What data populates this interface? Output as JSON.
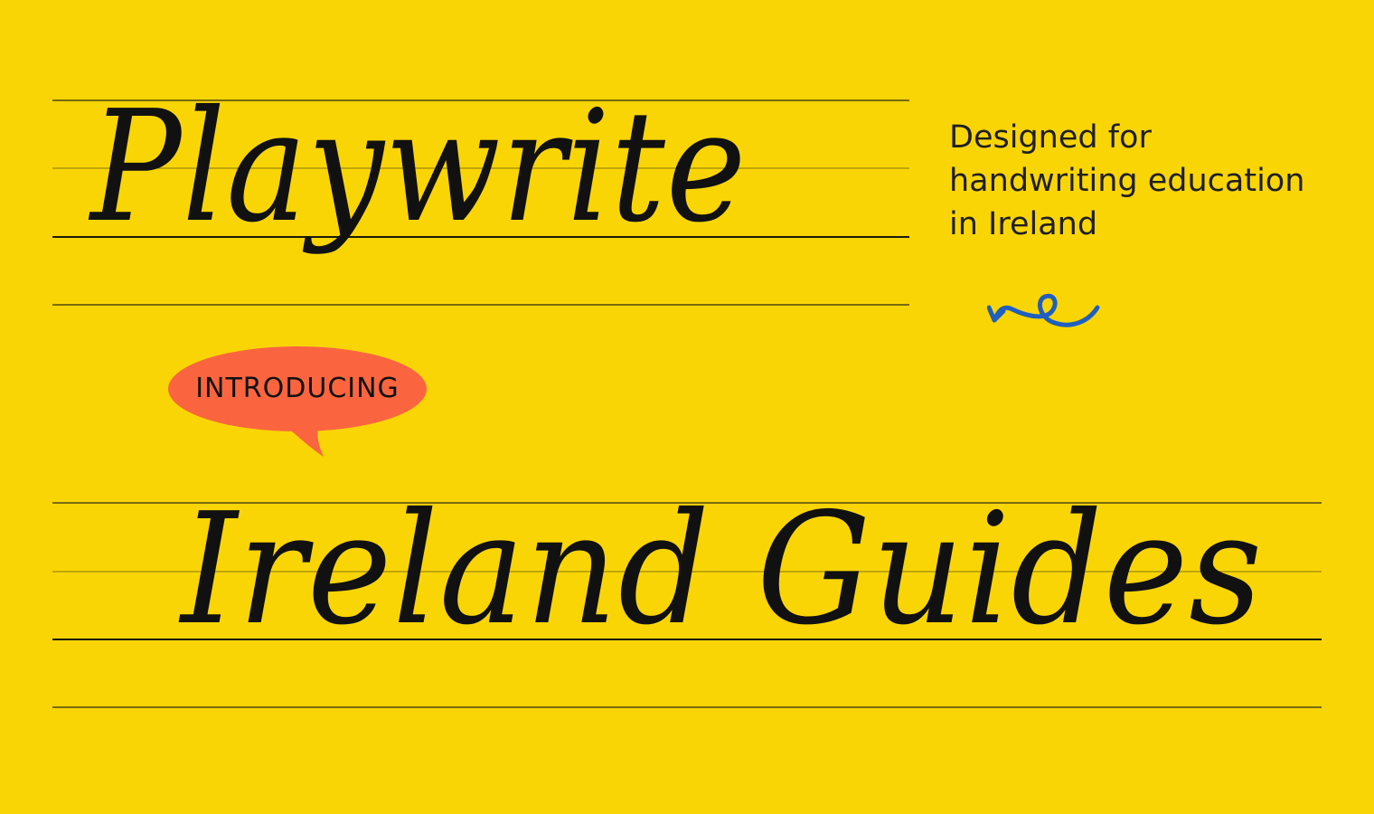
{
  "colors": {
    "background": "#FAD505",
    "guide_line": "#2a2a12",
    "bubble": "#FA653F",
    "squiggle_arrow": "#1F5FBF",
    "text": "#111111"
  },
  "title_top": "Playwrite",
  "bubble_label": "INTRODUCING",
  "title_bottom": "Ireland Guides",
  "description": {
    "line1": "Designed for",
    "line2": "handwriting education",
    "line3": "in Ireland"
  },
  "icons": {
    "squiggle": "curly-arrow-icon"
  }
}
